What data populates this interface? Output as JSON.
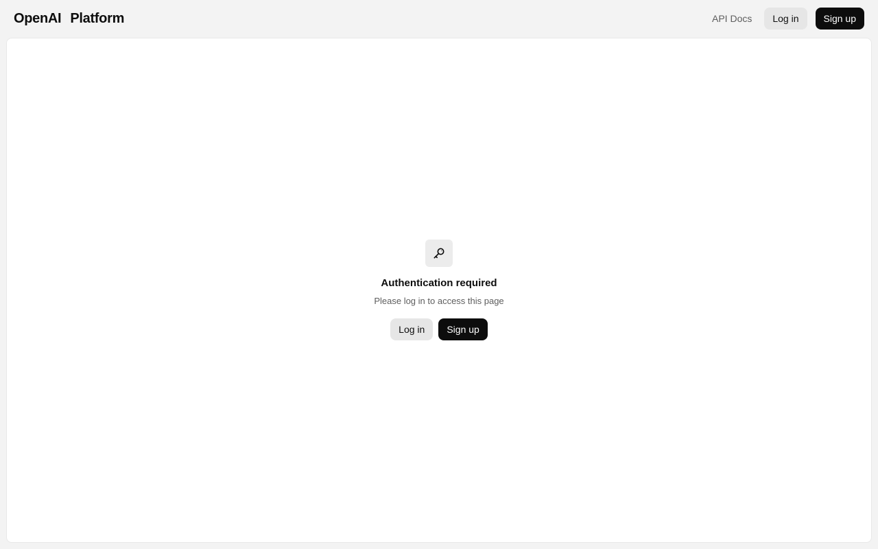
{
  "header": {
    "brand_name": "OpenAI",
    "brand_product": "Platform",
    "api_docs_label": "API Docs",
    "login_label": "Log in",
    "signup_label": "Sign up"
  },
  "main": {
    "icon": "key-icon",
    "title": "Authentication required",
    "subtitle": "Please log in to access this page",
    "login_label": "Log in",
    "signup_label": "Sign up"
  },
  "colors": {
    "background": "#f3f3f3",
    "card": "#ffffff",
    "primary_button": "#0d0d0d",
    "secondary_button": "#e6e6e6"
  }
}
